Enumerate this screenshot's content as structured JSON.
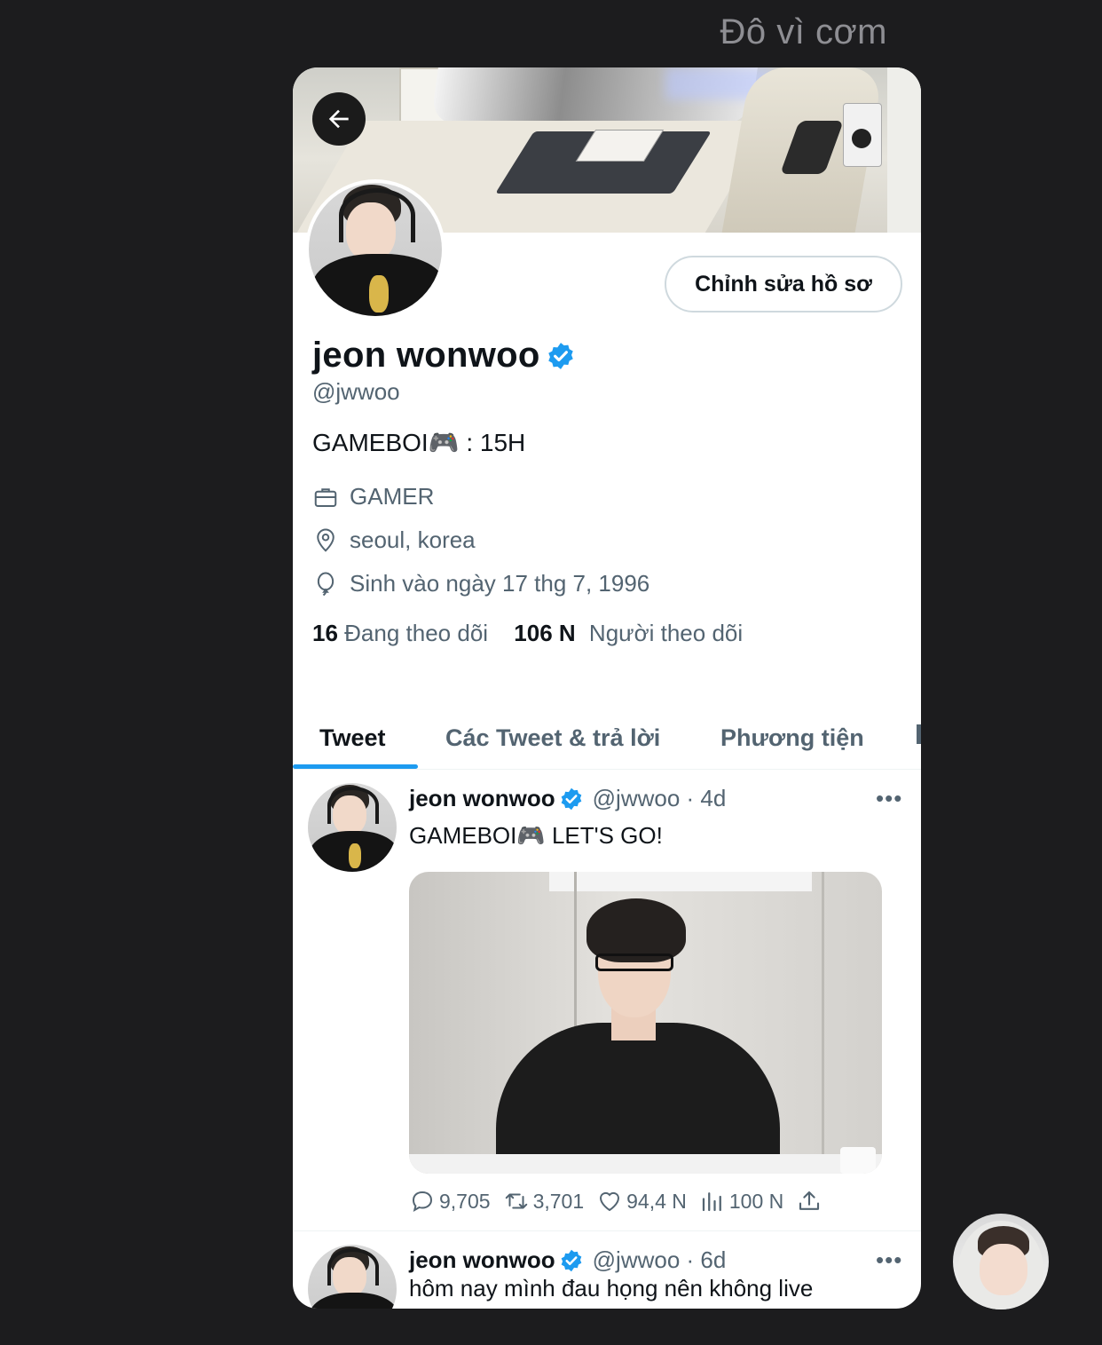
{
  "chat": {
    "contact_name": "Đô vì cơm"
  },
  "profile": {
    "edit_button": "Chỉnh sửa hồ sơ",
    "name": "jeon wonwoo",
    "handle": "@jwwoo",
    "bio": "GAMEBOI🎮 : 15H",
    "job": "GAMER",
    "location": "seoul, korea",
    "birthday": "Sinh vào ngày 17 thg 7, 1996",
    "following_count": "16",
    "following_label": "Đang theo dõi",
    "followers_count": "106 N",
    "followers_label": "Người theo dõi"
  },
  "tabs": [
    {
      "label": "Tweet",
      "active": true
    },
    {
      "label": "Các Tweet & trả lời",
      "active": false
    },
    {
      "label": "Phương tiện",
      "active": false
    }
  ],
  "tweets": [
    {
      "name": "jeon wonwoo",
      "handle_time": "@jwwoo · 4d",
      "more": "•••",
      "text": "GAMEBOI🎮  LET'S GO!",
      "replies": "9,705",
      "retweets": "3,701",
      "likes": "94,4 N",
      "views": "100 N"
    },
    {
      "name": "jeon wonwoo",
      "handle_time": "@jwwoo · 6d",
      "more": "•••",
      "text": "hôm nay mình đau họng nên không live"
    }
  ],
  "colors": {
    "accent": "#1d9bf0",
    "text": "#0f1419",
    "muted": "#536471",
    "chat_bg": "#1c1c1e"
  }
}
